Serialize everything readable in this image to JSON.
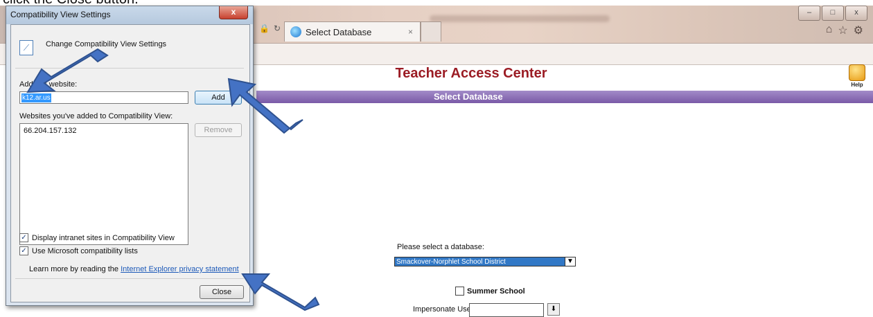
{
  "caption": "click the Close button.",
  "browser": {
    "tab_title": "Select Database",
    "tab_close": "×",
    "window_buttons": [
      "–",
      "□",
      "x"
    ],
    "toolbar_icons": [
      "home-icon",
      "star-icon",
      "gear-icon"
    ]
  },
  "page": {
    "title": "Teacher Access Center",
    "help_label": "Help",
    "bar_title": "Select Database",
    "db_label": "Please select a database:",
    "db_selected": "Smackover-Norphlet School District",
    "summer_label": "Summer School",
    "impersonate_label": "Impersonate User:"
  },
  "dialog": {
    "title": "Compatibility View Settings",
    "close_x": "x",
    "header": "Change Compatibility View Settings",
    "add_label": "Add this website:",
    "site_value": "k12.ar.us",
    "add_button": "Add",
    "list_label": "Websites you've added to Compatibility View:",
    "sites": [
      "66.204.157.132"
    ],
    "remove_button": "Remove",
    "checkbox_intranet": "Display intranet sites in Compatibility View",
    "checkbox_mslists": "Use Microsoft compatibility lists",
    "learn_prefix": "Learn more by reading the ",
    "learn_link": "Internet Explorer privacy statement",
    "close_button": "Close"
  },
  "colors": {
    "arrow": "#4472c4",
    "title_red": "#9b1c24",
    "purple_bar": "#8a6bb8"
  }
}
